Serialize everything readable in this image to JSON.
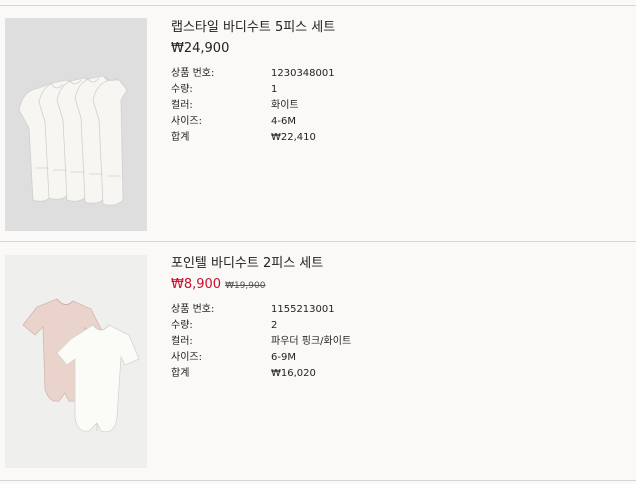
{
  "items": [
    {
      "name": "랩스타일 바디수트 5피스 세트",
      "price": "₩24,900",
      "details": [
        {
          "label": "상품 번호:",
          "value": "1230348001"
        },
        {
          "label": "수량:",
          "value": "1"
        },
        {
          "label": "컬러:",
          "value": "화이트"
        },
        {
          "label": "사이즈:",
          "value": "4-6M"
        },
        {
          "label": "합계",
          "value": "₩22,410"
        }
      ]
    },
    {
      "name": "포인텔 바디수트 2피스 세트",
      "price": "₩8,900",
      "original_price": "₩19,900",
      "details": [
        {
          "label": "상품 번호:",
          "value": "1155213001"
        },
        {
          "label": "수량:",
          "value": "2"
        },
        {
          "label": "컬러:",
          "value": "파우더 핑크/화이트"
        },
        {
          "label": "사이즈:",
          "value": "6-9M"
        },
        {
          "label": "합계",
          "value": "₩16,020"
        }
      ]
    }
  ],
  "colors": {
    "background": "#faf9f8",
    "text": "#222222",
    "sale_price": "#c8102e",
    "divider": "#d8d6d3"
  },
  "icons": {
    "item_1_image": "white-bodysuits-stack-image",
    "item_2_image": "pink-and-white-bodysuits-image"
  }
}
